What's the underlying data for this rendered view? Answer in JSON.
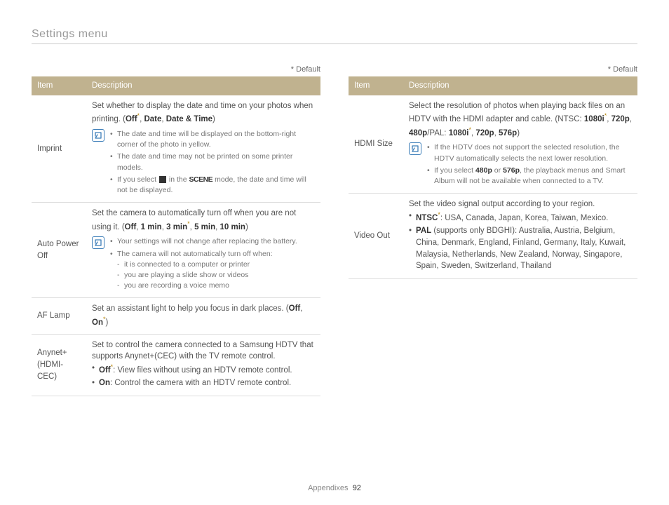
{
  "page": {
    "title": "Settings menu",
    "default_note": "* Default",
    "footer_section": "Appendixes",
    "footer_page": "92"
  },
  "headers": {
    "item": "Item",
    "description": "Description"
  },
  "left": {
    "imprint": {
      "item": "Imprint",
      "intro": "Set whether to display the date and time on your photos when printing. (",
      "opts": {
        "off": "Off",
        "date": "Date",
        "datetime": "Date & Time"
      },
      "close": ")",
      "notes": {
        "n1": "The date and time will be displayed on the bottom-right corner of the photo in yellow.",
        "n2": "The date and time may not be printed on some printer models.",
        "n3a": "If you select ",
        "n3b": " in the ",
        "n3_scene": "SCENE",
        "n3c": " mode, the date and time will not be displayed."
      }
    },
    "autopower": {
      "item": "Auto Power Off",
      "intro": "Set the camera to automatically turn off when you are not using it. (",
      "opts": {
        "off": "Off",
        "m1": "1 min",
        "m3": "3 min",
        "m5": "5 min",
        "m10": "10 min"
      },
      "close": ")",
      "notes": {
        "n1": "Your settings will not change after replacing the battery.",
        "n2": "The camera will not automatically turn off when:",
        "d1": "it is connected to a computer or printer",
        "d2": "you are playing a slide show or videos",
        "d3": "you are recording a voice memo"
      }
    },
    "aflamp": {
      "item": "AF Lamp",
      "intro": "Set an assistant light to help you focus in dark places. (",
      "opts": {
        "off": "Off",
        "on": "On"
      },
      "close": ")"
    },
    "anynet": {
      "item": "Anynet+ (HDMI-CEC)",
      "intro": "Set to control the camera connected to a Samsung HDTV that supports Anynet+(CEC) with the TV remote control.",
      "b1_label": "Off",
      "b1_text": ": View files without using an HDTV remote control.",
      "b2_label": "On",
      "b2_text": ": Control the camera with an HDTV remote control."
    }
  },
  "right": {
    "hdmi": {
      "item": "HDMI Size",
      "intro": "Select the resolution of photos when playing back files on an HDTV with the HDMI adapter and cable. (NTSC: ",
      "opts": {
        "a": "1080i",
        "b": "720p",
        "c": "480p",
        "sep": "/PAL: ",
        "d": "1080i",
        "e": "720p",
        "f": "576p"
      },
      "close": ")",
      "notes": {
        "n1": "If the HDTV does not support the selected resolution, the HDTV automatically selects the next lower resolution.",
        "n2a": "If you select ",
        "n2b": "480p",
        "n2c": " or ",
        "n2d": "576p",
        "n2e": ", the playback menus and Smart Album will not be available when connected to a TV."
      }
    },
    "video": {
      "item": "Video Out",
      "intro": "Set the video signal output according to your region.",
      "b1_label": "NTSC",
      "b1_text": ": USA, Canada, Japan, Korea, Taiwan, Mexico.",
      "b2_label": "PAL",
      "b2_support": " (supports only BDGHI)",
      "b2_text": ": Australia, Austria, Belgium, China, Denmark, England, Finland, Germany, Italy, Kuwait, Malaysia, Netherlands, New Zealand, Norway, Singapore, Spain, Sweden, Switzerland, Thailand"
    }
  }
}
